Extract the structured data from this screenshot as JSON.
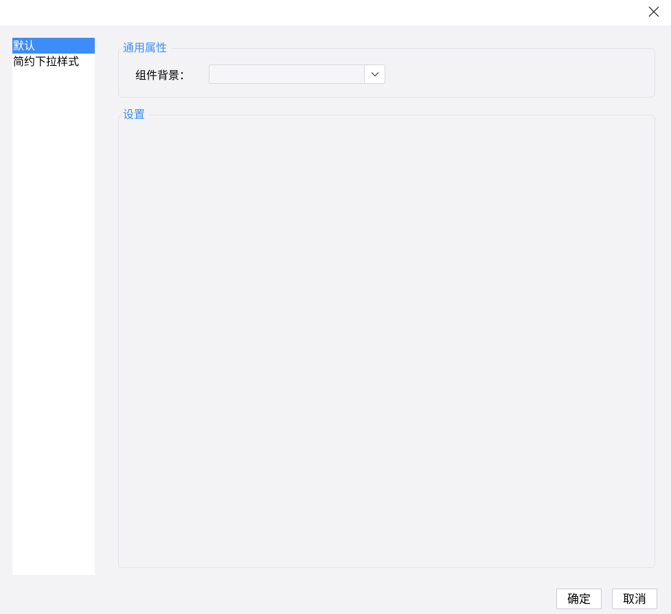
{
  "dialog": {
    "close_icon": "close-icon"
  },
  "style_list": {
    "items": [
      {
        "label": "默认",
        "selected": true
      },
      {
        "label": "简约下拉样式",
        "selected": false
      }
    ]
  },
  "general_group": {
    "title": "通用属性",
    "background_label": "组件背景：",
    "background_value": "",
    "dropdown_icon": "chevron-down-icon"
  },
  "settings_group": {
    "title": "设置"
  },
  "footer": {
    "ok_label": "确定",
    "cancel_label": "取消"
  },
  "colors": {
    "accent": "#3d8cf7",
    "background": "#f3f3f5",
    "panel_border": "#e2e3e7"
  }
}
